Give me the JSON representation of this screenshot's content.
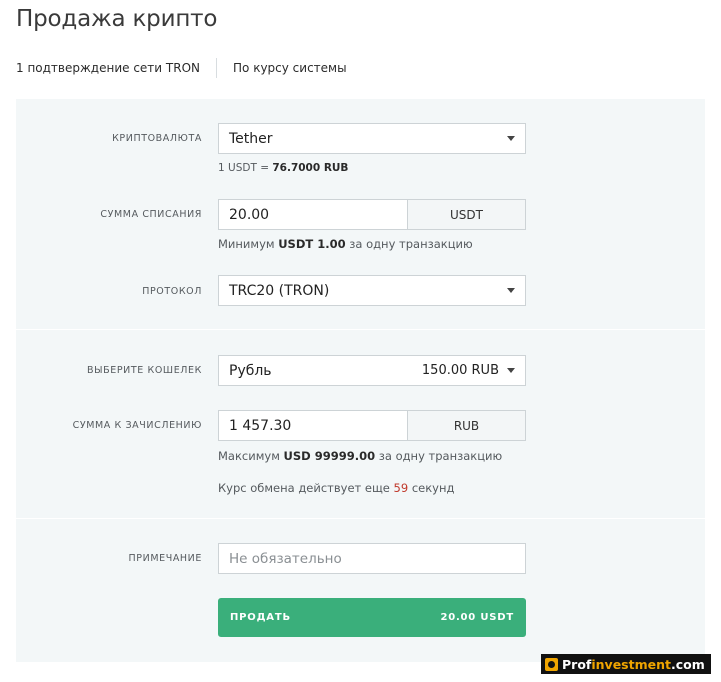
{
  "page": {
    "title": "Продажа крипто"
  },
  "info_bar": {
    "confirmations": "1 подтверждение сети TRON",
    "rate_mode": "По курсу системы"
  },
  "crypto": {
    "label": "КРИПТОВАЛЮТА",
    "selected": "Tether",
    "rate_prefix": "1 USDT = ",
    "rate_value": "76.7000 RUB"
  },
  "debit": {
    "label": "СУММА СПИСАНИЯ",
    "value": "20.00",
    "currency": "USDT",
    "hint_prefix": "Минимум ",
    "hint_value": "USDT 1.00",
    "hint_suffix": " за одну транзакцию"
  },
  "protocol": {
    "label": "ПРОТОКОЛ",
    "selected": "TRC20 (TRON)"
  },
  "wallet": {
    "label": "ВЫБЕРИТЕ КОШЕЛЕК",
    "selected": "Рубль",
    "balance": "150.00 RUB"
  },
  "credit": {
    "label": "СУММА К ЗАЧИСЛЕНИЮ",
    "value": "1 457.30",
    "currency": "RUB",
    "hint_prefix": "Максимум ",
    "hint_value": "USD 99999.00",
    "hint_suffix": " за одну транзакцию"
  },
  "timer": {
    "prefix": "Курс обмена действует еще ",
    "seconds": "59",
    "suffix": " секунд"
  },
  "note": {
    "label": "ПРИМЕЧАНИЕ",
    "placeholder": "Не обязательно"
  },
  "submit": {
    "label": "ПРОДАТЬ",
    "amount": "20.00 USDT"
  },
  "watermark": {
    "part1": "Prof",
    "part2": "investment",
    "part3": ".com"
  },
  "colors": {
    "accent": "#3aaf7b",
    "panel_bg": "#f3f7f8",
    "countdown": "#c0392b",
    "watermark_accent": "#f0a500"
  }
}
